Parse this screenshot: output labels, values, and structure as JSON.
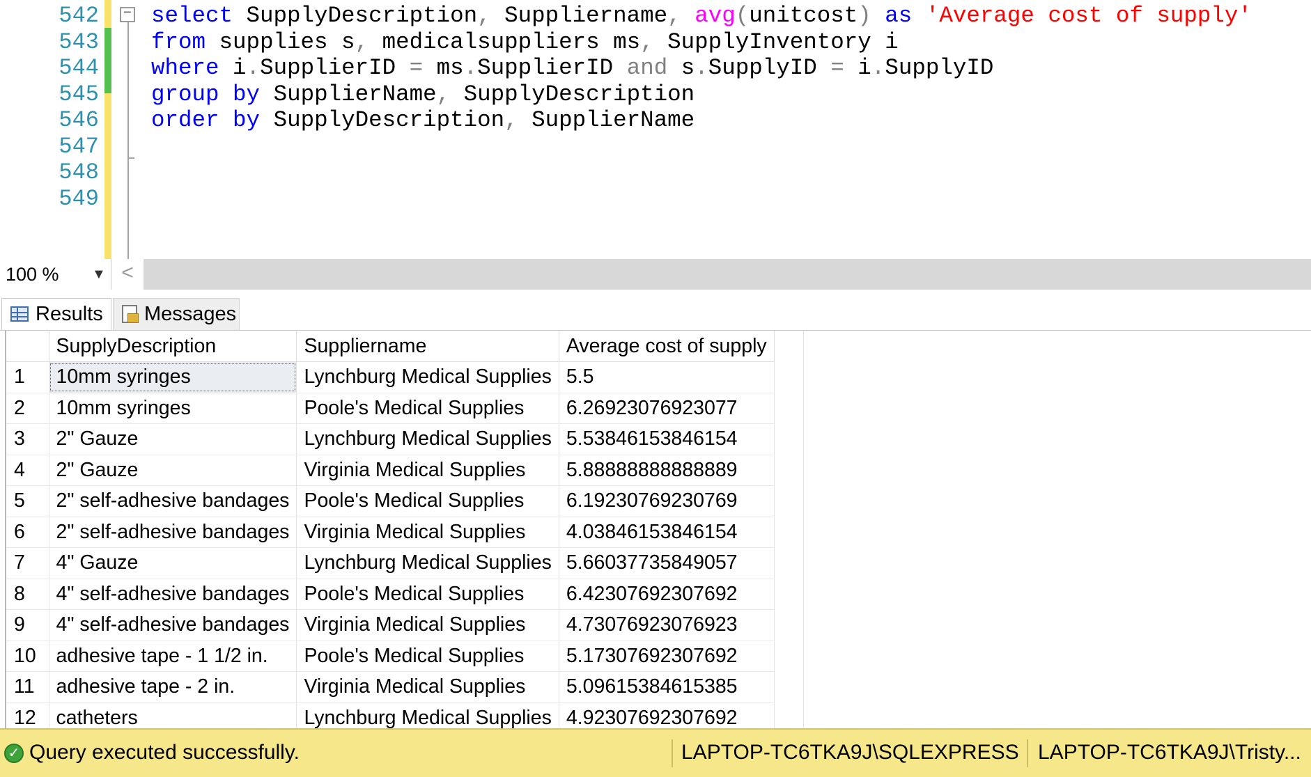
{
  "editor": {
    "line_numbers": [
      "542",
      "543",
      "544",
      "545",
      "546",
      "547",
      "548",
      "549"
    ],
    "code": {
      "l542": {
        "t1": "select",
        "t2": " SupplyDescription",
        "t3": ",",
        "t4": " Suppliername",
        "t5": ",",
        "t6": " ",
        "t7": "avg",
        "t8": "(",
        "t9": "unitcost",
        "t10": ")",
        "t11": " ",
        "t12": "as",
        "t13": " ",
        "t14": "'Average cost of supply'"
      },
      "l543": {
        "t1": "from",
        "t2": " supplies s",
        "t3": ",",
        "t4": " medicalsuppliers ms",
        "t5": ",",
        "t6": " SupplyInventory i"
      },
      "l544": {
        "t1": "where",
        "t2": " i",
        "t3": ".",
        "t4": "SupplierID ",
        "t5": "=",
        "t6": " ms",
        "t7": ".",
        "t8": "SupplierID ",
        "t9": "and",
        "t10": " s",
        "t11": ".",
        "t12": "SupplyID ",
        "t13": "=",
        "t14": " i",
        "t15": ".",
        "t16": "SupplyID"
      },
      "l545": {
        "t1": "group",
        "t2": " ",
        "t3": "by",
        "t4": " SupplierName",
        "t5": ",",
        "t6": " SupplyDescription"
      },
      "l546": {
        "t1": "order",
        "t2": " ",
        "t3": "by",
        "t4": " SupplyDescription",
        "t5": ",",
        "t6": " SupplierName"
      }
    },
    "collapse_glyph": "−"
  },
  "zoom": {
    "value": "100 %",
    "caret": "▼",
    "scroll_left": "<"
  },
  "tabs": {
    "results": "Results",
    "messages": "Messages"
  },
  "results": {
    "columns": [
      "SupplyDescription",
      "Suppliername",
      "Average cost of supply"
    ],
    "rows": [
      {
        "n": "1",
        "desc": "10mm syringes",
        "supplier": "Lynchburg Medical Supplies",
        "avg": "5.5"
      },
      {
        "n": "2",
        "desc": "10mm syringes",
        "supplier": "Poole's Medical Supplies",
        "avg": "6.26923076923077"
      },
      {
        "n": "3",
        "desc": "2\" Gauze",
        "supplier": "Lynchburg Medical Supplies",
        "avg": "5.53846153846154"
      },
      {
        "n": "4",
        "desc": "2\" Gauze",
        "supplier": "Virginia Medical Supplies",
        "avg": "5.88888888888889"
      },
      {
        "n": "5",
        "desc": "2\" self-adhesive bandages",
        "supplier": "Poole's Medical Supplies",
        "avg": "6.19230769230769"
      },
      {
        "n": "6",
        "desc": "2\" self-adhesive bandages",
        "supplier": "Virginia Medical Supplies",
        "avg": "4.03846153846154"
      },
      {
        "n": "7",
        "desc": "4\" Gauze",
        "supplier": "Lynchburg Medical Supplies",
        "avg": "5.66037735849057"
      },
      {
        "n": "8",
        "desc": "4\" self-adhesive bandages",
        "supplier": "Poole's Medical Supplies",
        "avg": "6.42307692307692"
      },
      {
        "n": "9",
        "desc": "4\" self-adhesive bandages",
        "supplier": "Virginia Medical Supplies",
        "avg": "4.73076923076923"
      },
      {
        "n": "10",
        "desc": "adhesive tape - 1 1/2 in.",
        "supplier": "Poole's Medical Supplies",
        "avg": "5.17307692307692"
      },
      {
        "n": "11",
        "desc": "adhesive tape - 2 in.",
        "supplier": "Virginia Medical Supplies",
        "avg": "5.09615384615385"
      },
      {
        "n": "12",
        "desc": "catheters",
        "supplier": "Lynchburg Medical Supplies",
        "avg": "4.92307692307692"
      }
    ]
  },
  "status": {
    "message": "Query executed successfully.",
    "ok_glyph": "✓",
    "server": "LAPTOP-TC6TKA9J\\SQLEXPRESS ...",
    "user": "LAPTOP-TC6TKA9J\\Tristy..."
  },
  "colors": {
    "keyword": "#0000ff",
    "function": "#ff00ff",
    "string": "#ff0000",
    "line_number": "#2b91af",
    "status_bar": "#f6e88a"
  },
  "icons": {
    "results_tab": "grid-icon",
    "messages_tab": "messages-icon",
    "status": "success-check-icon",
    "outline": "collapse-minus-icon"
  }
}
